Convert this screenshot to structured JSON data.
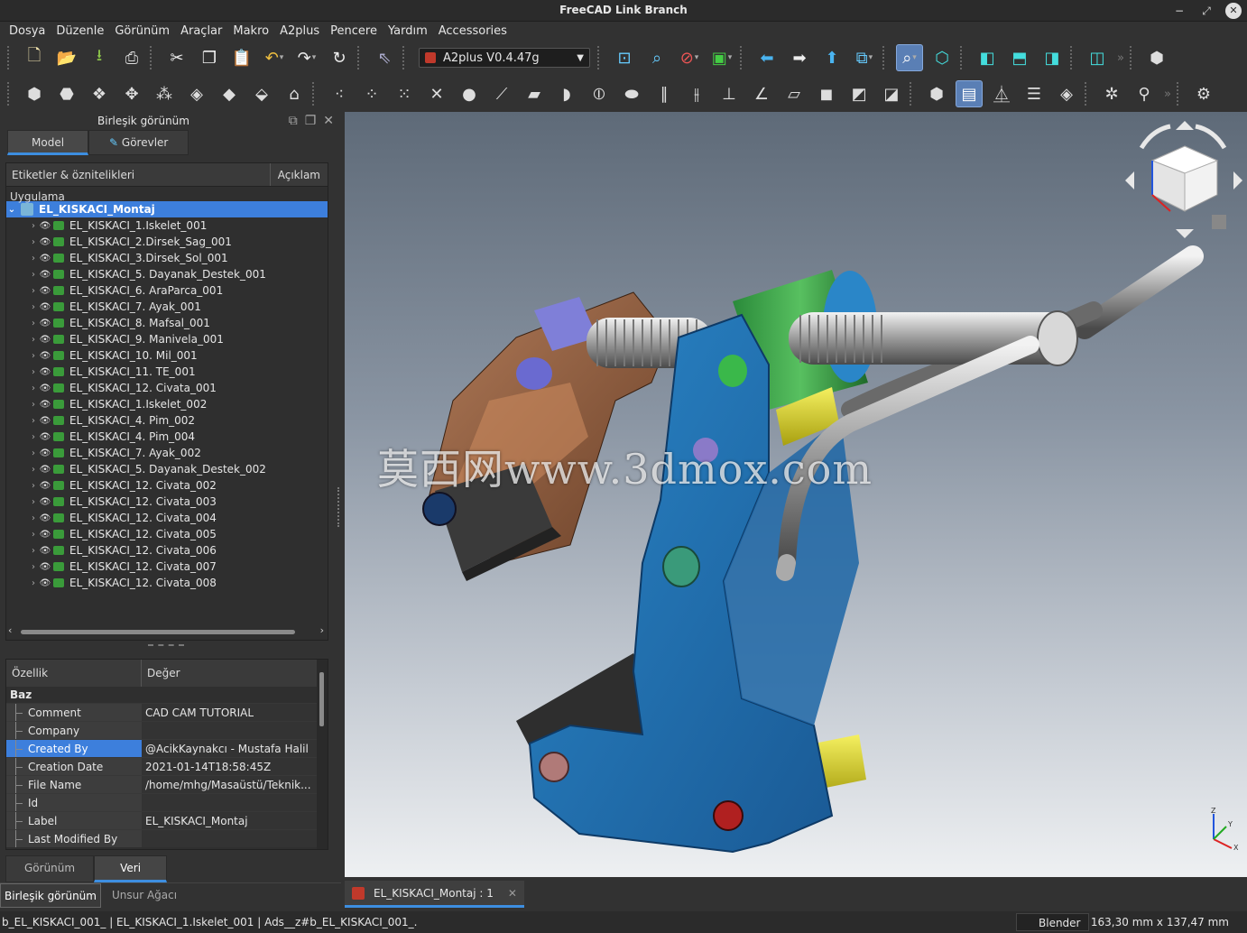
{
  "window": {
    "title": "FreeCAD Link Branch"
  },
  "menu": [
    "Dosya",
    "Düzenle",
    "Görünüm",
    "Araçlar",
    "Makro",
    "A2plus",
    "Pencere",
    "Yardım",
    "Accessories"
  ],
  "toolbar": {
    "workbench": "A2plus V0.4.47g"
  },
  "combo": {
    "title": "Birleşik görünüm",
    "tabs": {
      "model": "Model",
      "tasks": "Görevler"
    },
    "tree_header": {
      "labels": "Etiketler & öznitelikleri",
      "description": "Açıklam"
    },
    "section": "Uygulama",
    "root": "EL_KISKACI_Montaj",
    "items": [
      "EL_KISKACI_1.Iskelet_001",
      "EL_KISKACI_2.Dirsek_Sag_001",
      "EL_KISKACI_3.Dirsek_Sol_001",
      "EL_KISKACI_5. Dayanak_Destek_001",
      "EL_KISKACI_6. AraParca_001",
      "EL_KISKACI_7. Ayak_001",
      "EL_KISKACI_8. Mafsal_001",
      "EL_KISKACI_9. Manivela_001",
      "EL_KISKACI_10. Mil_001",
      "EL_KISKACI_11. TE_001",
      "EL_KISKACI_12. Civata_001",
      "EL_KISKACI_1.Iskelet_002",
      "EL_KISKACI_4. Pim_002",
      "EL_KISKACI_4. Pim_004",
      "EL_KISKACI_7. Ayak_002",
      "EL_KISKACI_5. Dayanak_Destek_002",
      "EL_KISKACI_12. Civata_002",
      "EL_KISKACI_12. Civata_003",
      "EL_KISKACI_12. Civata_004",
      "EL_KISKACI_12. Civata_005",
      "EL_KISKACI_12. Civata_006",
      "EL_KISKACI_12. Civata_007",
      "EL_KISKACI_12. Civata_008"
    ]
  },
  "properties": {
    "header": {
      "property": "Özellik",
      "value": "Değer"
    },
    "group": "Baz",
    "rows": [
      {
        "key": "Comment",
        "value": "CAD CAM TUTORIAL"
      },
      {
        "key": "Company",
        "value": ""
      },
      {
        "key": "Created By",
        "value": "@AcikKaynakcı - Mustafa Halil"
      },
      {
        "key": "Creation Date",
        "value": "2021-01-14T18:58:45Z"
      },
      {
        "key": "File Name",
        "value": "/home/mhg/Masaüstü/Teknik..."
      },
      {
        "key": "Id",
        "value": ""
      },
      {
        "key": "Label",
        "value": "EL_KISKACI_Montaj"
      },
      {
        "key": "Last Modified By",
        "value": ""
      }
    ],
    "tabs": {
      "view": "Görünüm",
      "data": "Veri"
    }
  },
  "panel_tabs": {
    "combo": "Birleşik görünüm",
    "tree": "Unsur Ağacı"
  },
  "viewport": {
    "watermark": "莫西网www.3dmox.com"
  },
  "document_tab": {
    "label": "EL_KISKACI_Montaj : 1"
  },
  "status": {
    "message": "b_EL_KISKACI_001_ | EL_KISKACI_1.Iskelet_001 | Ads__z#b_EL_KISKACI_001_.",
    "navigation": "Blender",
    "dimensions": "163,30 mm x 137,47 mm"
  },
  "colors": {
    "selection": "#3d7fdc",
    "accent": "#3d8ee0",
    "frame_blue": "#1f6fae",
    "copper": "#8a5a3c"
  }
}
